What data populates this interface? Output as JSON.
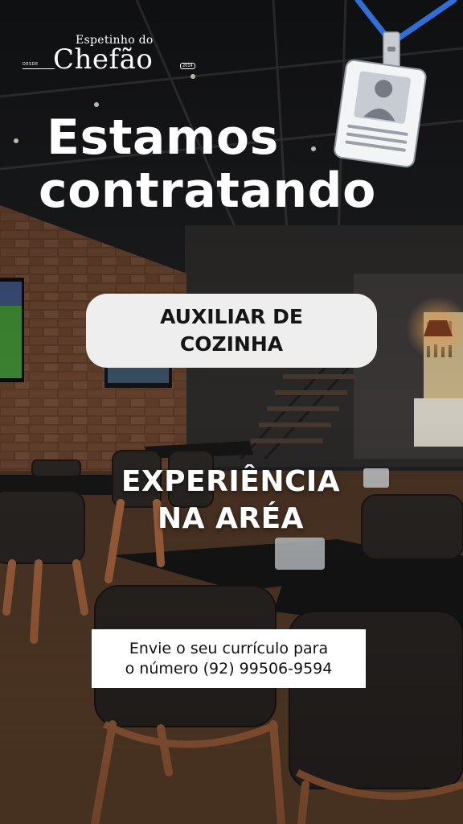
{
  "logo": {
    "top_text": "Espetinho do",
    "main_text": "Chefão",
    "desde_text": "DESDE",
    "year_text": "2014"
  },
  "headline": {
    "line1": "Estamos",
    "line2": "contratando"
  },
  "position": {
    "label": "AUXILIAR DE COZINHA"
  },
  "requirement": {
    "line1": "EXPERIÊNCIA",
    "line2": "NA ARÉA"
  },
  "contact": {
    "line1": "Envie o seu currículo para",
    "line2": "o número (92) 99506-9594"
  },
  "colors": {
    "lanyard": "#2f6fd6",
    "pill_bg": "#eeeeee",
    "text_light": "#ffffff",
    "text_dark": "#151515"
  }
}
